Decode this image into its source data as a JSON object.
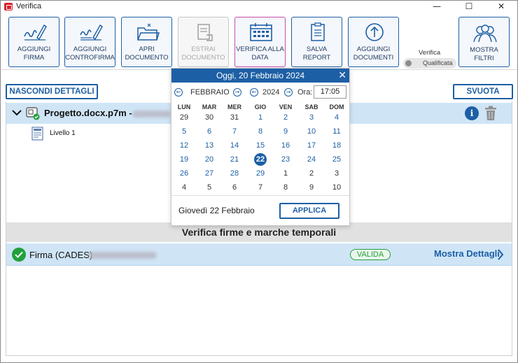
{
  "window": {
    "title": "Verifica",
    "minimize": "—",
    "maximize": "☐",
    "close": "✕"
  },
  "toolbar": {
    "buttons": [
      {
        "label": "AGGIUNGI\nFIRMA",
        "icon": "signature-pen-icon",
        "disabled": false
      },
      {
        "label": "AGGIUNGI\nCONTROFIRMA",
        "icon": "countersignature-pen-icon",
        "disabled": false
      },
      {
        "label": "APRI\nDOCUMENTO",
        "icon": "open-folder-icon",
        "disabled": false
      },
      {
        "label": "ESTRAI\nDOCUMENTO",
        "icon": "extract-document-icon",
        "disabled": true
      },
      {
        "label": "VERIFICA ALLA\nDATA",
        "icon": "calendar-icon",
        "disabled": false
      },
      {
        "label": "SALVA\nREPORT",
        "icon": "report-icon",
        "disabled": false
      },
      {
        "label": "AGGIUNGI\nDOCUMENTI",
        "icon": "upload-arrow-icon",
        "disabled": false
      },
      {
        "label": "MOSTRA\nFILTRI",
        "icon": "users-filter-icon",
        "disabled": false
      }
    ],
    "verifica_label": "Verifica",
    "toggle_label": "Qualificata"
  },
  "actions": {
    "hide_details": "NASCONDI DETTAGLI",
    "clear": "SVUOTA"
  },
  "file": {
    "name": "Progetto.docx.p7m -",
    "level": "Livello 1"
  },
  "section": {
    "title": "Verifica firme e marche temporali"
  },
  "signature": {
    "label": "Firma (CADES)",
    "status": "VALIDA",
    "details_link": "Mostra Dettagli"
  },
  "calendar": {
    "header": "Oggi, 20 Febbraio 2024",
    "month": "FEBBRAIO",
    "year": "2024",
    "time_label": "Ora:",
    "time_value": "17:05",
    "weekdays": [
      "LUN",
      "MAR",
      "MER",
      "GIO",
      "VEN",
      "SAB",
      "DOM"
    ],
    "weeks": [
      [
        "29",
        "30",
        "31",
        "1",
        "2",
        "3",
        "4"
      ],
      [
        "5",
        "6",
        "7",
        "8",
        "9",
        "10",
        "11"
      ],
      [
        "12",
        "13",
        "14",
        "15",
        "16",
        "17",
        "18"
      ],
      [
        "19",
        "20",
        "21",
        "22",
        "23",
        "24",
        "25"
      ],
      [
        "26",
        "27",
        "28",
        "29",
        "1",
        "2",
        "3"
      ],
      [
        "4",
        "5",
        "6",
        "7",
        "8",
        "9",
        "10"
      ]
    ],
    "selected_date": "Giovedì 22 Febbraio",
    "apply_label": "APPLICA"
  },
  "colors": {
    "accent": "#1d5fa5",
    "valid": "#22a03c",
    "row_highlight": "#cfe5f6"
  }
}
